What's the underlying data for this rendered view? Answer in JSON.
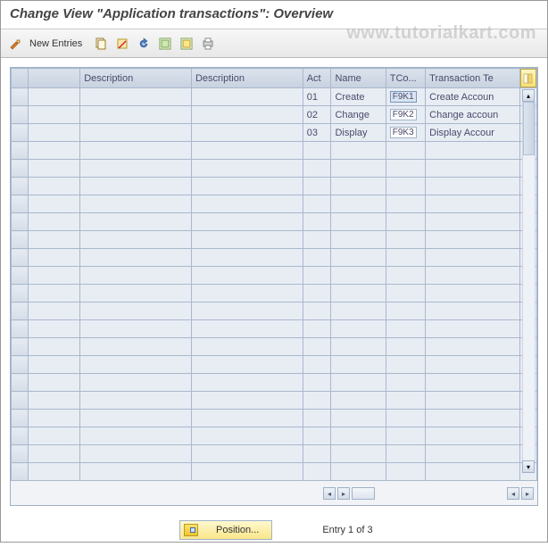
{
  "title": "Change View \"Application transactions\": Overview",
  "watermark": "www.tutorialkart.com",
  "toolbar": {
    "new_entries": "New Entries"
  },
  "columns": {
    "blank1": "",
    "desc1": "Description",
    "desc2": "Description",
    "act": "Act",
    "name": "Name",
    "tco": "TCo...",
    "txt": "Transaction Te"
  },
  "rows": [
    {
      "blank1": "",
      "desc1": "",
      "desc2": "",
      "act": "01",
      "name": "Create",
      "tco": "F9K1",
      "txt": "Create Accoun",
      "selected": true
    },
    {
      "blank1": "",
      "desc1": "",
      "desc2": "",
      "act": "02",
      "name": "Change",
      "tco": "F9K2",
      "txt": "Change accoun",
      "selected": false
    },
    {
      "blank1": "",
      "desc1": "",
      "desc2": "",
      "act": "03",
      "name": "Display",
      "tco": "F9K3",
      "txt": "Display Accour",
      "selected": false
    }
  ],
  "empty_row_count": 19,
  "footer": {
    "position_label": "Position...",
    "entry_counter": "Entry 1 of 3"
  }
}
